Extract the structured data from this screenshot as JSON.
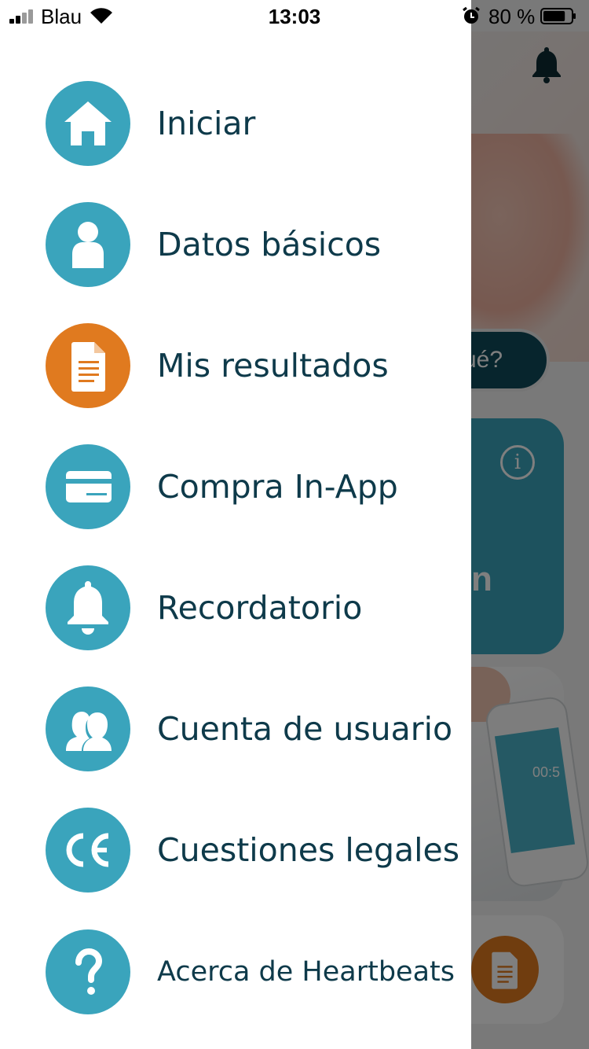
{
  "status_bar": {
    "carrier": "Blau",
    "time": "13:03",
    "battery_percent": "80 %",
    "battery_level": 0.8
  },
  "background": {
    "pill_text": "ué?",
    "card_text": "n",
    "info_glyph": "i",
    "phone_timer": "00:5"
  },
  "menu": {
    "items": [
      {
        "label": "Iniciar",
        "icon": "home-icon",
        "color": "#3aa4bc"
      },
      {
        "label": "Datos básicos",
        "icon": "user-icon",
        "color": "#3aa4bc"
      },
      {
        "label": "Mis resultados",
        "icon": "document-icon",
        "color": "#e07a1f"
      },
      {
        "label": "Compra In-App",
        "icon": "credit-card-icon",
        "color": "#3aa4bc"
      },
      {
        "label": "Recordatorio",
        "icon": "bell-icon",
        "color": "#3aa4bc"
      },
      {
        "label": "Cuenta de usuario",
        "icon": "users-icon",
        "color": "#3aa4bc"
      },
      {
        "label": "Cuestiones legales",
        "icon": "ce-mark-icon",
        "color": "#3aa4bc"
      },
      {
        "label": "Acerca de Heartbeats",
        "icon": "question-icon",
        "color": "#3aa4bc"
      }
    ]
  },
  "colors": {
    "teal": "#3aa4bc",
    "orange": "#e07a1f",
    "label_text": "#0e3a4a"
  }
}
